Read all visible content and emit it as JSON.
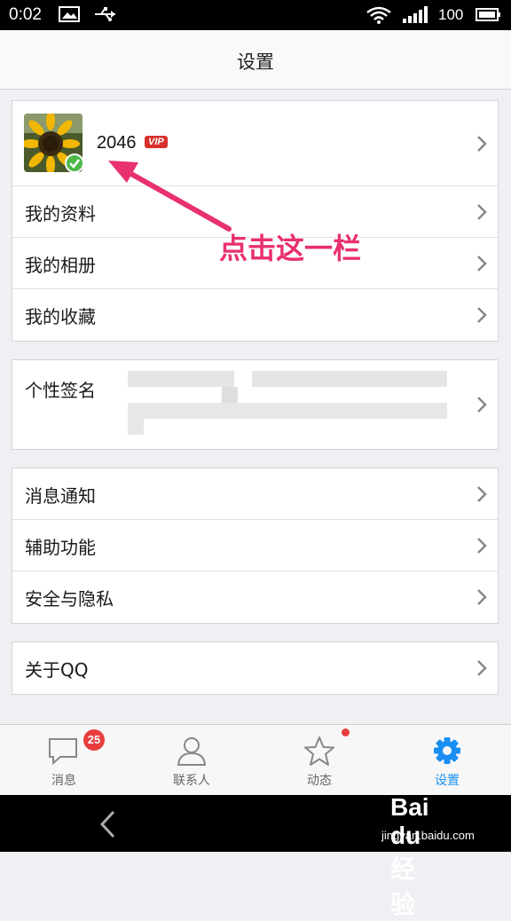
{
  "status_bar": {
    "time": "0:02",
    "battery": "100"
  },
  "header": {
    "title": "设置"
  },
  "profile": {
    "nickname": "2046",
    "badge": "VIP"
  },
  "group1": {
    "items": [
      {
        "label": "我的资料"
      },
      {
        "label": "我的相册"
      },
      {
        "label": "我的收藏"
      }
    ]
  },
  "signature": {
    "label": "个性签名"
  },
  "group2": {
    "items": [
      {
        "label": "消息通知"
      },
      {
        "label": "辅助功能"
      },
      {
        "label": "安全与隐私"
      }
    ]
  },
  "group3": {
    "items": [
      {
        "label": "关于QQ"
      }
    ]
  },
  "annotation": {
    "text": "点击这一栏"
  },
  "tabs": [
    {
      "label": "消息",
      "badge": "25",
      "icon": "message-icon"
    },
    {
      "label": "联系人",
      "icon": "contacts-icon"
    },
    {
      "label": "动态",
      "icon": "star-icon"
    },
    {
      "label": "设置",
      "icon": "gear-icon"
    }
  ],
  "watermark": {
    "logo": "Bai du 经验",
    "url": "jingyan.baidu.com"
  },
  "colors": {
    "accent": "#1a8ef2",
    "badge": "#e93d3d",
    "annotation": "#e8316d",
    "verified": "#4cb849"
  }
}
